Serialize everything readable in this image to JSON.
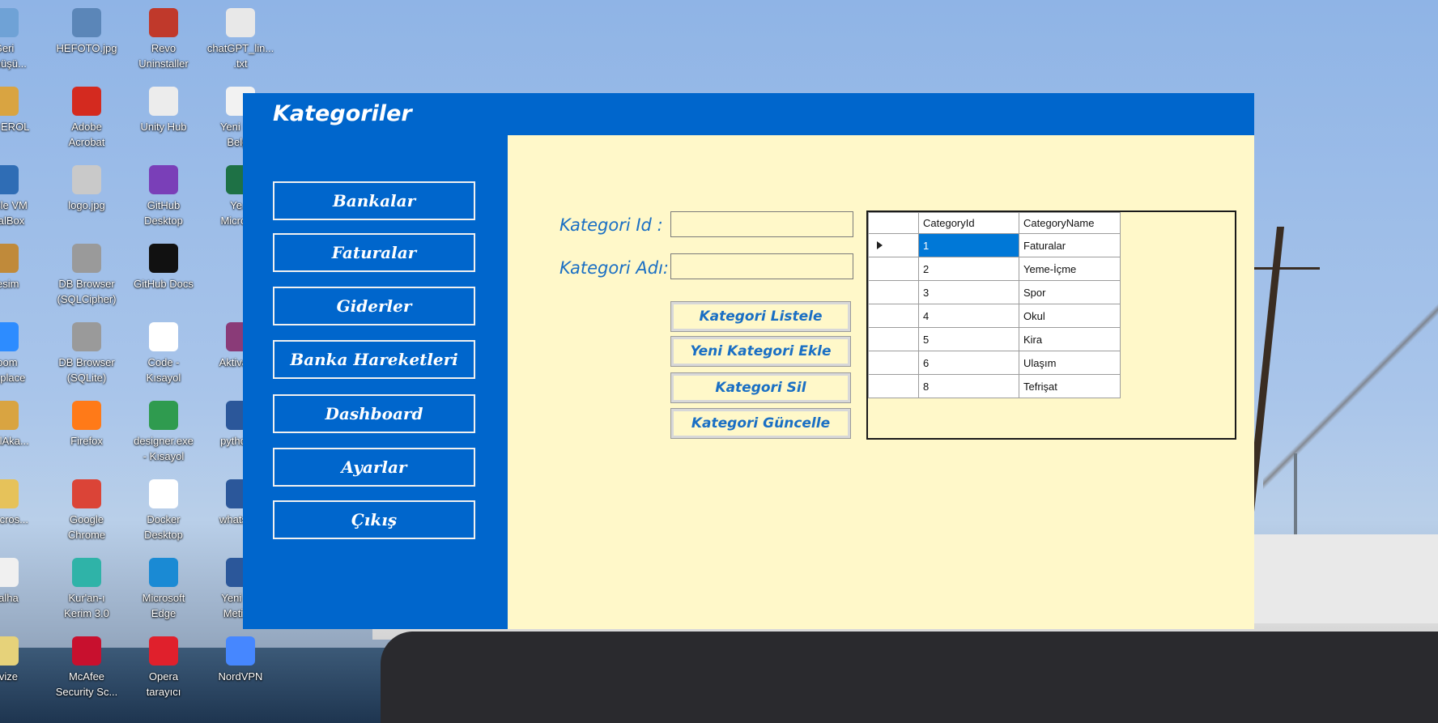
{
  "desktop": {
    "icons": [
      {
        "label": "Geri\nDönüşü...",
        "icon": "recycle-bin-icon",
        "color": "#6fa2d6"
      },
      {
        "label": "HEFOTO.jpg",
        "icon": "image-file-icon",
        "color": "#5b86b8"
      },
      {
        "label": "Revo\nUninstaller",
        "icon": "revo-uninstaller-icon",
        "color": "#c0392b"
      },
      {
        "label": "chatGPT_lin...\n.txt",
        "icon": "text-file-icon",
        "color": "#e8e8e8"
      },
      {
        "label": "...IN EROL",
        "icon": "user-folder-icon",
        "color": "#d9a441"
      },
      {
        "label": "Adobe\nAcrobat",
        "icon": "adobe-acrobat-icon",
        "color": "#d42a1f"
      },
      {
        "label": "Unity Hub",
        "icon": "unity-hub-icon",
        "color": "#ececec"
      },
      {
        "label": "Yeni M...\nBelge",
        "icon": "document-icon",
        "color": "#f2f2f2"
      },
      {
        "label": "...acle VM\n...ualBox",
        "icon": "virtualbox-icon",
        "color": "#2f6db5"
      },
      {
        "label": "logo.jpg",
        "icon": "image-file-icon",
        "color": "#c9c9c9"
      },
      {
        "label": "GitHub\nDesktop",
        "icon": "github-desktop-icon",
        "color": "#7a3fb8"
      },
      {
        "label": "Ye...\nMicros...",
        "icon": "excel-icon",
        "color": "#1e7145"
      },
      {
        "label": "Resim",
        "icon": "folder-icon",
        "color": "#c08a3a"
      },
      {
        "label": "DB Browser\n(SQLCipher)",
        "icon": "db-browser-icon",
        "color": "#9a9a9a"
      },
      {
        "label": "GitHub Docs",
        "icon": "github-icon",
        "color": "#111111"
      },
      {
        "label": "",
        "icon": "blank-icon",
        "color": "#00000000"
      },
      {
        "label": "Zoom\n...rkplace",
        "icon": "zoom-icon",
        "color": "#2d8cff"
      },
      {
        "label": "DB Browser\n(SQLite)",
        "icon": "db-browser-icon",
        "color": "#9a9a9a"
      },
      {
        "label": "Code -\nKısayol",
        "icon": "vscode-shortcut-icon",
        "color": "#ffffff"
      },
      {
        "label": "Aktivas...",
        "icon": "winrar-icon",
        "color": "#8a3b78"
      },
      {
        "label": "...bulAka...",
        "icon": "folder-icon",
        "color": "#d9a441"
      },
      {
        "label": "Firefox",
        "icon": "firefox-icon",
        "color": "#ff7a18"
      },
      {
        "label": "designer.exe\n- Kısayol",
        "icon": "designer-icon",
        "color": "#2f9b4f"
      },
      {
        "label": "python...",
        "icon": "word-icon",
        "color": "#2b579a"
      },
      {
        "label": "...Micros...",
        "icon": "folder-icon",
        "color": "#e6c25a"
      },
      {
        "label": "Google\nChrome",
        "icon": "chrome-icon",
        "color": "#db4437"
      },
      {
        "label": "Docker\nDesktop",
        "icon": "docker-icon",
        "color": "#ffffff"
      },
      {
        "label": "whatsa...",
        "icon": "word-icon",
        "color": "#2b579a"
      },
      {
        "label": "...alha",
        "icon": "document-icon",
        "color": "#f0f0f0"
      },
      {
        "label": "Kur'an-ı\nKerim 3.0",
        "icon": "quran-icon",
        "color": "#2fb3a8"
      },
      {
        "label": "Microsoft\nEdge",
        "icon": "edge-icon",
        "color": "#1a8ad4"
      },
      {
        "label": "Yeni Z...\nMetin...",
        "icon": "word-icon",
        "color": "#2b579a"
      },
      {
        "label": "...vize",
        "icon": "folder-icon",
        "color": "#e6d27a"
      },
      {
        "label": "McAfee\nSecurity Sc...",
        "icon": "mcafee-icon",
        "color": "#c8102e"
      },
      {
        "label": "Opera\ntarayıcı",
        "icon": "opera-icon",
        "color": "#e0202c"
      },
      {
        "label": "NordVPN",
        "icon": "nordvpn-icon",
        "color": "#4687ff"
      }
    ]
  },
  "app": {
    "title": "Kategoriler",
    "nav": [
      {
        "label": "Bankalar",
        "name": "nav-button-bankalar"
      },
      {
        "label": "Faturalar",
        "name": "nav-button-faturalar"
      },
      {
        "label": "Giderler",
        "name": "nav-button-giderler"
      },
      {
        "label": "Banka Hareketleri",
        "name": "nav-button-banka-hareketleri"
      },
      {
        "label": "Dashboard",
        "name": "nav-button-dashboard"
      },
      {
        "label": "Ayarlar",
        "name": "nav-button-ayarlar"
      },
      {
        "label": "Çıkış",
        "name": "nav-button-cikis"
      }
    ],
    "form": {
      "id_label": "Kategori Id :",
      "id_value": "",
      "name_label": "Kategori Adı:",
      "name_value": ""
    },
    "buttons": {
      "list": "Kategori Listele",
      "add": "Yeni Kategori Ekle",
      "delete": "Kategori Sil",
      "update": "Kategori Güncelle"
    },
    "grid": {
      "columns": [
        "CategoryId",
        "CategoryName"
      ],
      "rows": [
        {
          "id": "1",
          "name": "Faturalar"
        },
        {
          "id": "2",
          "name": "Yeme-İçme"
        },
        {
          "id": "3",
          "name": "Spor"
        },
        {
          "id": "4",
          "name": "Okul"
        },
        {
          "id": "5",
          "name": "Kira"
        },
        {
          "id": "6",
          "name": "Ulaşım"
        },
        {
          "id": "8",
          "name": "Tefrişat"
        }
      ],
      "selected_row": 0
    }
  },
  "colors": {
    "accent": "#0066cc",
    "panel": "#fff8c9",
    "label_text": "#1a6fc4",
    "selection": "#0078d7"
  }
}
